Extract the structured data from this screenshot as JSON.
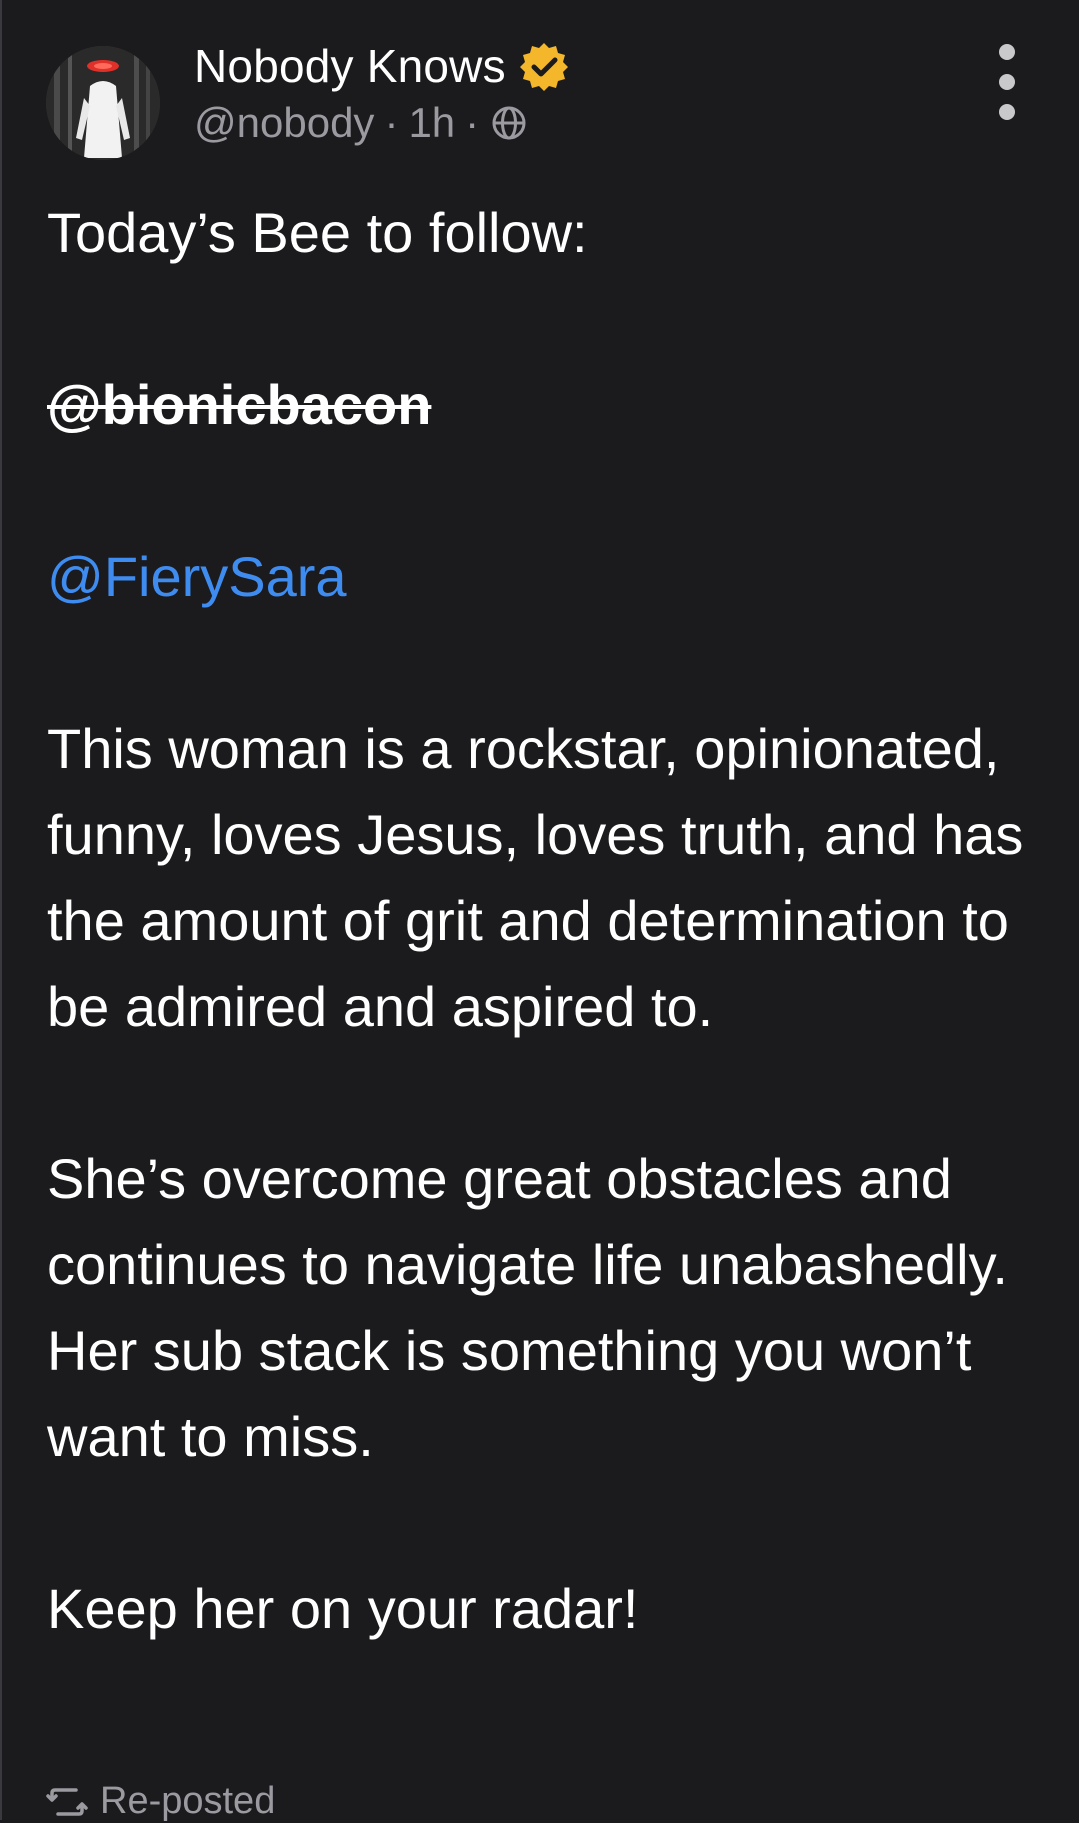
{
  "post": {
    "author_name": "Nobody Knows",
    "handle": "@nobody",
    "time": "1h",
    "separator": "·",
    "verified": true,
    "colors": {
      "background": "#1b1b1d",
      "text": "#ffffff",
      "muted": "#9a9aa0",
      "link": "#3f8cf0",
      "verified_badge": "#f4b72c"
    },
    "icons": {
      "verified": "verified-check-badge-icon",
      "visibility": "globe-icon",
      "more": "more-vertical-icon",
      "repost": "repost-icon"
    },
    "content": {
      "line_intro": "Today’s Bee to follow:",
      "struck_mention": "@bionicbacon",
      "mention": "@FierySara",
      "paragraph_1": "This woman is a rockstar, opinionated, funny, loves Jesus, loves truth, and has the amount of grit and determination to be admired and aspired to.",
      "paragraph_2": "She’s overcome great obstacles and continues to navigate life unabashedly. Her sub stack is something you won’t want to miss.",
      "paragraph_3": "Keep her on your radar!"
    },
    "repost_label": "Re-posted"
  }
}
